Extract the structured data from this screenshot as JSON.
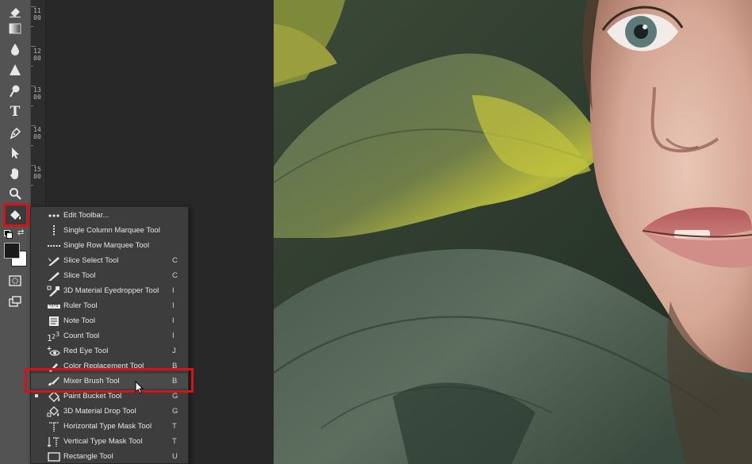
{
  "toolbar": {
    "tools": [
      {
        "name": "eraser-tool",
        "icon": "eraser-icon"
      },
      {
        "name": "gradient-tool",
        "icon": "gradient-icon"
      },
      {
        "name": "blur-tool",
        "icon": "droplet-icon"
      },
      {
        "name": "sharpen-tool",
        "icon": "triangle-icon"
      },
      {
        "name": "dodge-tool",
        "icon": "dodge-icon"
      },
      {
        "name": "type-tool",
        "icon": "type-icon",
        "glyph": "T"
      },
      {
        "name": "pen-tool",
        "icon": "pen-icon"
      },
      {
        "name": "path-selection-tool",
        "icon": "arrow-cursor-icon"
      },
      {
        "name": "hand-tool",
        "icon": "hand-icon"
      },
      {
        "name": "zoom-tool",
        "icon": "magnifier-icon"
      },
      {
        "name": "paint-bucket-tool",
        "icon": "paint-bucket-icon"
      }
    ],
    "foreground_color": "#1a1a1a",
    "background_color": "#ffffff"
  },
  "ruler": {
    "labels": [
      "1100",
      "1200",
      "1300",
      "1400",
      "1500"
    ]
  },
  "flyout": {
    "items": [
      {
        "label": "Edit Toolbar...",
        "key": "",
        "icon": "more-dots-icon"
      },
      {
        "label": "Single Column Marquee Tool",
        "key": "",
        "icon": "single-column-marquee-icon"
      },
      {
        "label": "Single Row Marquee Tool",
        "key": "",
        "icon": "single-row-marquee-icon"
      },
      {
        "label": "Slice Select Tool",
        "key": "C",
        "icon": "slice-select-icon"
      },
      {
        "label": "Slice Tool",
        "key": "C",
        "icon": "slice-icon"
      },
      {
        "label": "3D Material Eyedropper Tool",
        "key": "I",
        "icon": "eyedropper-3d-icon"
      },
      {
        "label": "Ruler Tool",
        "key": "I",
        "icon": "ruler-icon"
      },
      {
        "label": "Note Tool",
        "key": "I",
        "icon": "note-icon"
      },
      {
        "label": "Count Tool",
        "key": "I",
        "icon": "count-icon"
      },
      {
        "label": "Red Eye Tool",
        "key": "J",
        "icon": "red-eye-icon"
      },
      {
        "label": "Color Replacement Tool",
        "key": "B",
        "icon": "color-replacement-icon"
      },
      {
        "label": "Mixer Brush Tool",
        "key": "B",
        "icon": "mixer-brush-icon"
      },
      {
        "label": "Paint Bucket Tool",
        "key": "G",
        "icon": "paint-bucket-icon"
      },
      {
        "label": "3D Material Drop Tool",
        "key": "G",
        "icon": "material-drop-icon"
      },
      {
        "label": "Horizontal Type Mask Tool",
        "key": "T",
        "icon": "horizontal-type-mask-icon"
      },
      {
        "label": "Vertical Type Mask Tool",
        "key": "T",
        "icon": "vertical-type-mask-icon"
      },
      {
        "label": "Rectangle Tool",
        "key": "U",
        "icon": "rectangle-icon"
      }
    ]
  },
  "colors": {
    "highlight": "#d6121a",
    "panel": "#535353",
    "menu": "#3d3d3d"
  }
}
